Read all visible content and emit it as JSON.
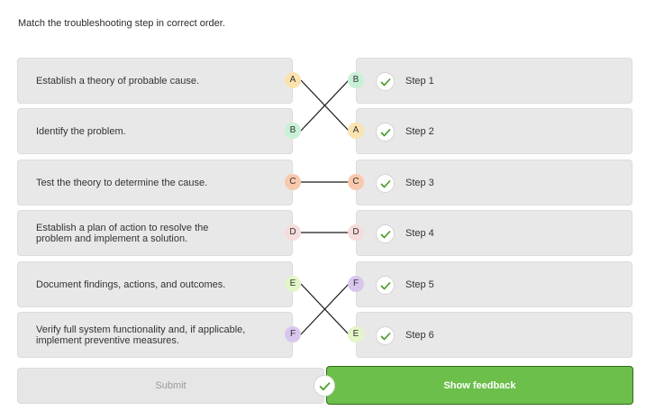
{
  "instruction": "Match the troubleshooting step in correct order.",
  "colors": {
    "A": "#fbe3b0",
    "B": "#c8f0d6",
    "C": "#f8c9ac",
    "D": "#f7dcdc",
    "E": "#e3f6c8",
    "F": "#d9c6ee",
    "check_green": "#3f9b22",
    "feedback_green": "#6cbf4a"
  },
  "left_items": [
    {
      "text": "Establish a theory of probable cause.",
      "badge": "A"
    },
    {
      "text": "Identify the problem.",
      "badge": "B"
    },
    {
      "text": "Test the theory to determine the cause.",
      "badge": "C"
    },
    {
      "text": "Establish a plan of action to resolve the problem and implement a solution.",
      "badge": "D"
    },
    {
      "text": "Document findings, actions, and outcomes.",
      "badge": "E"
    },
    {
      "text": "Verify full system functionality and, if applicable, implement preventive measures.",
      "badge": "F"
    }
  ],
  "right_items": [
    {
      "label": "Step 1",
      "badge": "B"
    },
    {
      "label": "Step 2",
      "badge": "A"
    },
    {
      "label": "Step 3",
      "badge": "C"
    },
    {
      "label": "Step 4",
      "badge": "D"
    },
    {
      "label": "Step 5",
      "badge": "F"
    },
    {
      "label": "Step 6",
      "badge": "E"
    }
  ],
  "buttons": {
    "submit": "Submit",
    "show_feedback": "Show feedback"
  }
}
